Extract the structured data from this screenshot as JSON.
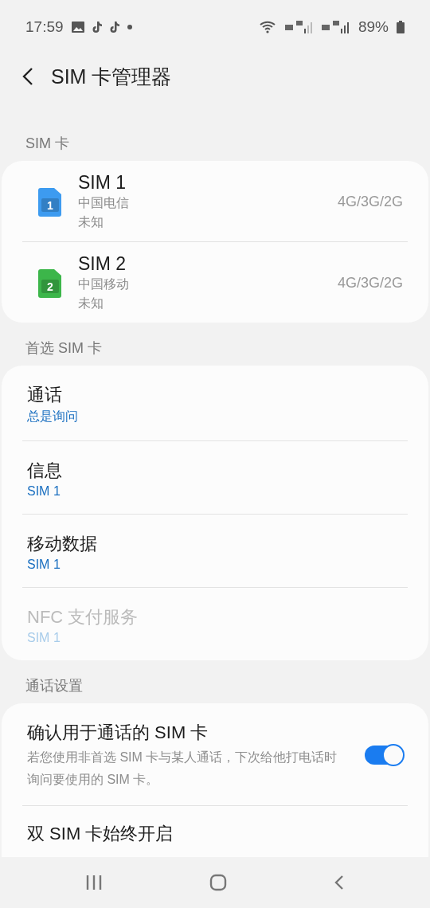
{
  "status_bar": {
    "time": "17:59",
    "battery": "89%"
  },
  "header": {
    "title": "SIM 卡管理器"
  },
  "sections": [
    {
      "title": "SIM 卡",
      "kind": "sims",
      "items": [
        {
          "name": "SIM 1",
          "carrier": "中国电信",
          "status": "未知",
          "network": "4G/3G/2G",
          "number": "1",
          "color": "#3d9bf0"
        },
        {
          "name": "SIM 2",
          "carrier": "中国移动",
          "status": "未知",
          "network": "4G/3G/2G",
          "number": "2",
          "color": "#3cb64a"
        }
      ]
    },
    {
      "title": "首选 SIM 卡",
      "kind": "prefs",
      "items": [
        {
          "label": "通话",
          "value": "总是询问",
          "disabled": false
        },
        {
          "label": "信息",
          "value": "SIM 1",
          "disabled": false
        },
        {
          "label": "移动数据",
          "value": "SIM 1",
          "disabled": false
        },
        {
          "label": "NFC 支付服务",
          "value": "SIM 1",
          "disabled": true
        }
      ]
    },
    {
      "title": "通话设置",
      "kind": "settings",
      "items": [
        {
          "label": "确认用于通话的 SIM 卡",
          "description": "若您使用非首选 SIM 卡与某人通话，下次给他打电话时询问要使用的 SIM 卡。",
          "on": true
        },
        {
          "label": "双 SIM 卡始终开启"
        }
      ]
    }
  ]
}
